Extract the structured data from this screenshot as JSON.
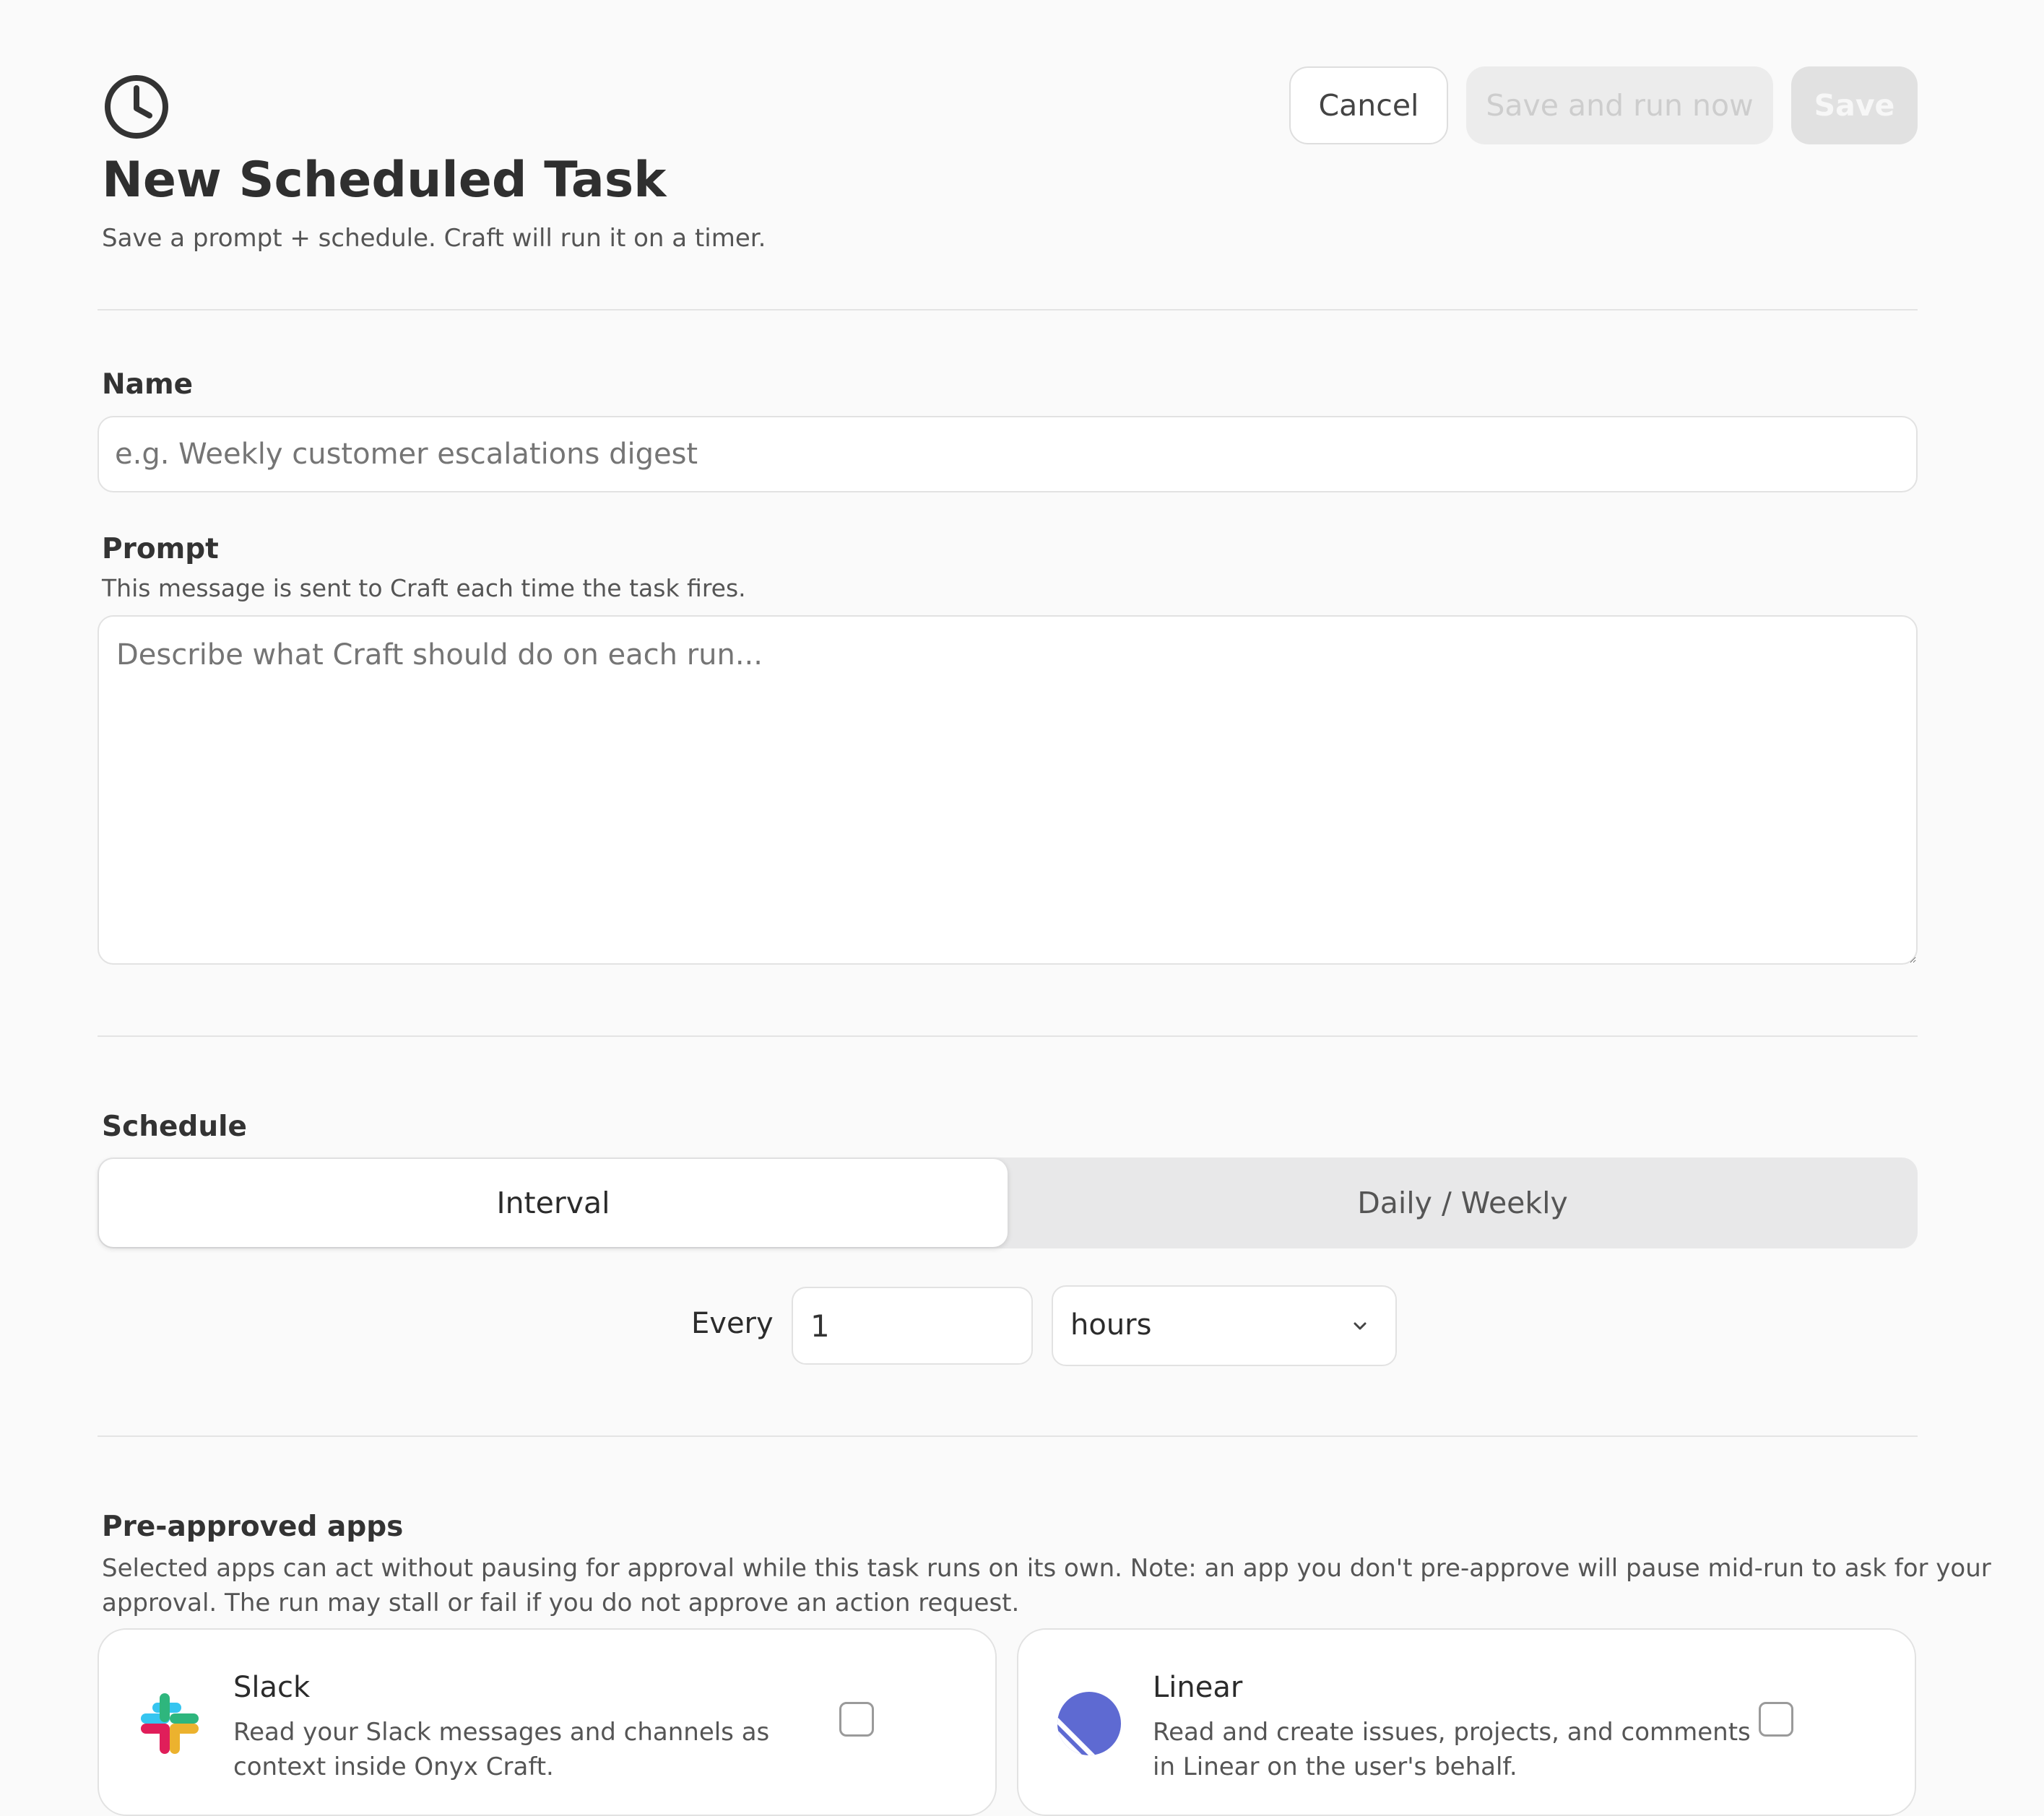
{
  "header": {
    "title": "New Scheduled Task",
    "subtitle": "Save a prompt + schedule. Craft will run it on a timer.",
    "icon": "clock-icon"
  },
  "actions": {
    "cancel_label": "Cancel",
    "save_run_label": "Save and run now",
    "save_label": "Save"
  },
  "name_field": {
    "label": "Name",
    "placeholder": "e.g. Weekly customer escalations digest",
    "value": ""
  },
  "prompt_field": {
    "label": "Prompt",
    "help": "This message is sent to Craft each time the task fires.",
    "placeholder": "Describe what Craft should do on each run...",
    "value": ""
  },
  "schedule": {
    "label": "Schedule",
    "tabs": [
      {
        "label": "Interval",
        "selected": true
      },
      {
        "label": "Daily / Weekly",
        "selected": false
      }
    ],
    "every_label": "Every",
    "interval_value": "1",
    "unit_value": "hours"
  },
  "apps": {
    "label": "Pre-approved apps",
    "help_line1": "Selected apps can act without pausing for approval while this task runs on its own. Note: an app you don't pre-approve will pause mid-run to ask for your",
    "help_line2": "approval. The run may stall or fail if you do not approve an action request.",
    "items": [
      {
        "name": "Slack",
        "description": "Read your Slack messages and channels as context inside Onyx Craft.",
        "icon": "slack-icon",
        "checked": false
      },
      {
        "name": "Linear",
        "description": "Read and create issues, projects, and comments in Linear on the user's behalf.",
        "icon": "linear-icon",
        "checked": false
      }
    ]
  },
  "colors": {
    "background": "#fafafa",
    "border": "#e2e2e2",
    "disabled_button": "#ececec",
    "linear_brand": "#5e6ad2"
  }
}
